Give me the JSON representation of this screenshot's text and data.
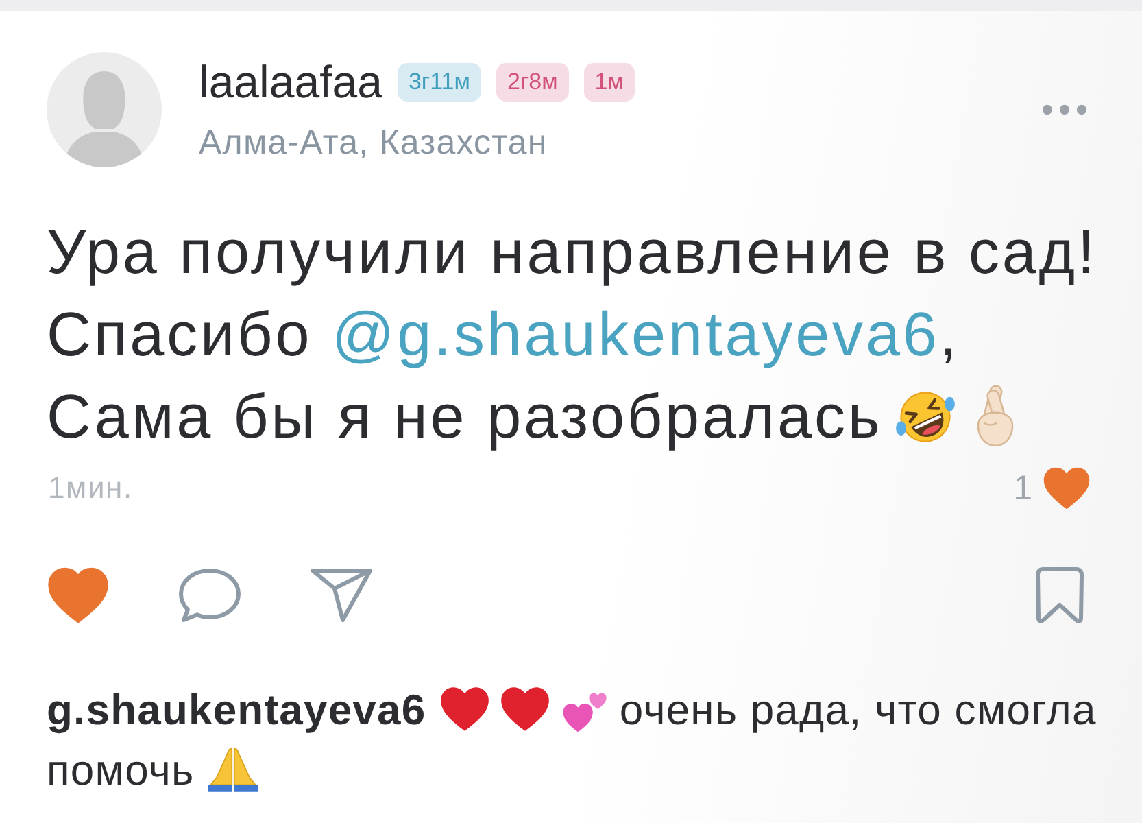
{
  "post": {
    "author": {
      "name": "laalaafaa",
      "badges": [
        {
          "text": "3г11м",
          "color": "#3f9dbd"
        },
        {
          "text": "2г8м",
          "color": "#d2527a"
        },
        {
          "text": "1м",
          "color": "#d2527a"
        }
      ],
      "location": "Алма-Ата, Казахстан"
    },
    "body": [
      {
        "kind": "text",
        "text": "Ура получили направление в сад!\nСпасибо "
      },
      {
        "kind": "mention",
        "text": "@g.shaukentayeva6"
      },
      {
        "kind": "text",
        "text": ",\nСама бы я не разобралась"
      }
    ],
    "time": "1мин.",
    "likes_count": "1",
    "liked": true
  },
  "comments": [
    {
      "author": "g.shaukentayeva6",
      "text": "очень рада, что смогла помочь"
    }
  ]
}
